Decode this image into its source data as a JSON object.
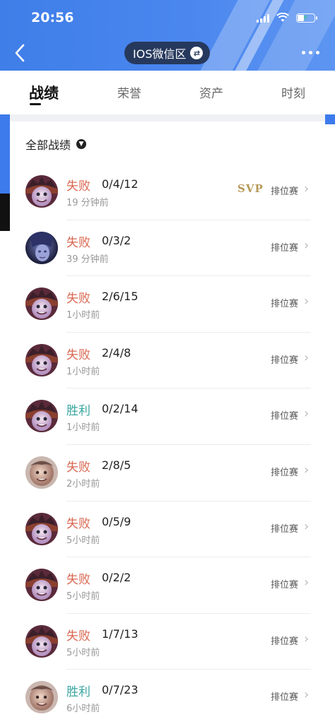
{
  "status_bar": {
    "time": "20:56"
  },
  "header": {
    "region": "IOS微信区"
  },
  "tabs": [
    "战绩",
    "荣誉",
    "资产",
    "时刻"
  ],
  "filter": {
    "label": "全部战绩"
  },
  "matches": [
    {
      "result": "失败",
      "kda": "0/4/12",
      "time": "19 分钟前",
      "badge": "SVP",
      "mode": "排位赛",
      "avatar": "hero-a",
      "outcome": "loss"
    },
    {
      "result": "失败",
      "kda": "0/3/2",
      "time": "39 分钟前",
      "badge": "",
      "mode": "排位赛",
      "avatar": "hero-b",
      "outcome": "loss"
    },
    {
      "result": "失败",
      "kda": "2/6/15",
      "time": "1小时前",
      "badge": "",
      "mode": "排位赛",
      "avatar": "hero-a",
      "outcome": "loss"
    },
    {
      "result": "失败",
      "kda": "2/4/8",
      "time": "1小时前",
      "badge": "",
      "mode": "排位赛",
      "avatar": "hero-a",
      "outcome": "loss"
    },
    {
      "result": "胜利",
      "kda": "0/2/14",
      "time": "1小时前",
      "badge": "",
      "mode": "排位赛",
      "avatar": "hero-a",
      "outcome": "win"
    },
    {
      "result": "失败",
      "kda": "2/8/5",
      "time": "2小时前",
      "badge": "",
      "mode": "排位赛",
      "avatar": "hero-c",
      "outcome": "loss"
    },
    {
      "result": "失败",
      "kda": "0/5/9",
      "time": "5小时前",
      "badge": "",
      "mode": "排位赛",
      "avatar": "hero-a",
      "outcome": "loss"
    },
    {
      "result": "失败",
      "kda": "0/2/2",
      "time": "5小时前",
      "badge": "",
      "mode": "排位赛",
      "avatar": "hero-a",
      "outcome": "loss"
    },
    {
      "result": "失败",
      "kda": "1/7/13",
      "time": "5小时前",
      "badge": "",
      "mode": "排位赛",
      "avatar": "hero-a",
      "outcome": "loss"
    },
    {
      "result": "胜利",
      "kda": "0/7/23",
      "time": "6小时前",
      "badge": "",
      "mode": "排位赛",
      "avatar": "hero-c",
      "outcome": "win"
    }
  ],
  "colors": {
    "loss": "#d9664f",
    "win": "#3aa6a0",
    "header_blue": "#4a86ee",
    "pill": "#26395d",
    "svp_gold": "#b79a5a"
  },
  "icons": [
    "back-arrow-icon",
    "swap-icon",
    "more-dots-icon",
    "caret-down-icon",
    "chevron-right-icon",
    "signal-icon",
    "wifi-icon",
    "battery-icon"
  ]
}
